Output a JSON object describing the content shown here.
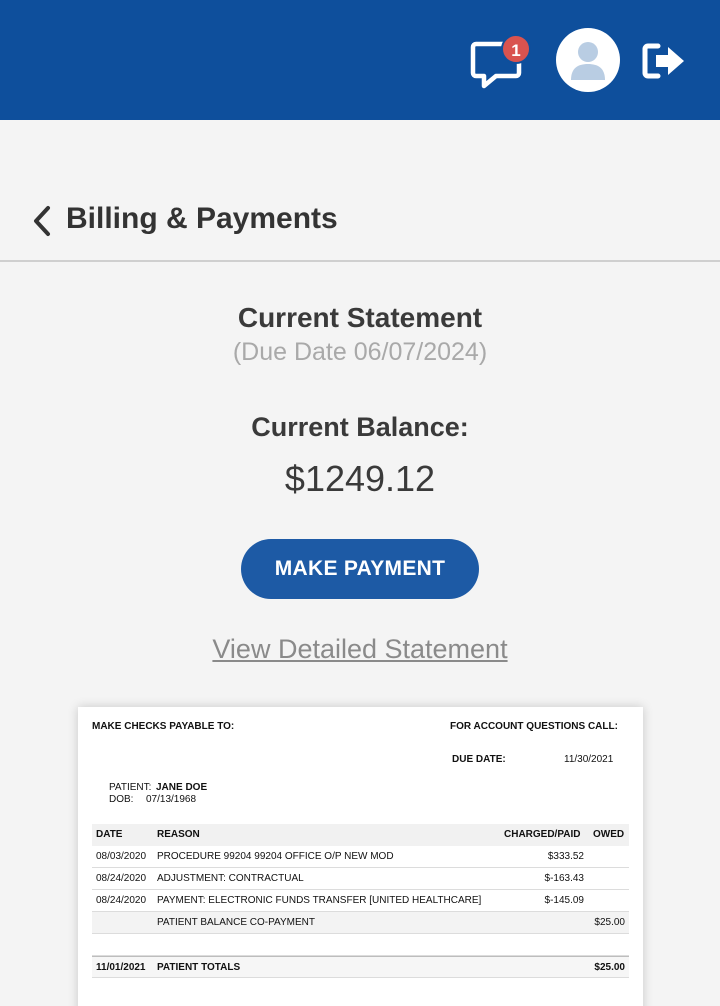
{
  "header": {
    "message_badge_count": "1",
    "colors": {
      "bar": "#0e4f9c",
      "badge": "#d9534f"
    }
  },
  "page": {
    "title": "Billing & Payments"
  },
  "statement": {
    "title": "Current Statement",
    "due_date": "(Due Date 06/07/2024)",
    "balance_label": "Current Balance:",
    "balance_value": "$1249.12",
    "make_payment_label": "MAKE PAYMENT",
    "view_detailed_label": "View Detailed Statement"
  },
  "preview": {
    "make_checks_label": "MAKE CHECKS PAYABLE TO:",
    "account_questions_label": "FOR ACCOUNT QUESTIONS CALL:",
    "due_date_label": "DUE DATE:",
    "due_date_value": "11/30/2021",
    "patient_label": "PATIENT:",
    "patient_value": "JANE DOE",
    "dob_label": "DOB:",
    "dob_value": "07/13/1968",
    "columns": {
      "date": "DATE",
      "reason": "REASON",
      "charged": "CHARGED/PAID",
      "owed": "OWED"
    },
    "rows": [
      {
        "date": "08/03/2020",
        "reason": "PROCEDURE 99204 99204 OFFICE O/P NEW MOD",
        "charged": "$333.52",
        "owed": ""
      },
      {
        "date": "08/24/2020",
        "reason": "ADJUSTMENT: CONTRACTUAL",
        "charged": "$-163.43",
        "owed": ""
      },
      {
        "date": "08/24/2020",
        "reason": "PAYMENT: ELECTRONIC FUNDS TRANSFER [UNITED HEALTHCARE]",
        "charged": "$-145.09",
        "owed": ""
      },
      {
        "date": "",
        "reason": "PATIENT BALANCE CO-PAYMENT",
        "charged": "",
        "owed": "$25.00"
      }
    ],
    "totals": {
      "date": "11/01/2021",
      "reason": "PATIENT TOTALS",
      "owed": "$25.00"
    }
  }
}
